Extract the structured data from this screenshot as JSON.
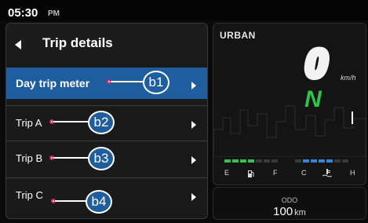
{
  "status": {
    "time": "05:30",
    "ampm": "PM"
  },
  "menu": {
    "title": "Trip details",
    "items": [
      {
        "label": "Day trip meter",
        "selected": true
      },
      {
        "label": "Trip A",
        "selected": false
      },
      {
        "label": "Trip B",
        "selected": false
      },
      {
        "label": "Trip C",
        "selected": false
      }
    ]
  },
  "callouts": [
    "b1",
    "b2",
    "b3",
    "b4"
  ],
  "cluster": {
    "mode": "URBAN",
    "speed": "0",
    "speed_unit": "km/h",
    "gear": "N",
    "fuel_labels": {
      "empty": "E",
      "full": "F"
    },
    "temp_labels": {
      "cold": "C",
      "hot": "H"
    },
    "fuel_level_segments": "4 of 7",
    "temp_level_segments": "4 of 7"
  },
  "odo": {
    "label": "ODO",
    "value": "100",
    "unit": "km"
  },
  "colors": {
    "accent": "#1f5e9e",
    "gauge_fuel": "#37c24a",
    "gauge_temp": "#3a82d6",
    "callout_dot": "#e0245e",
    "gear": "#2ec44a"
  }
}
